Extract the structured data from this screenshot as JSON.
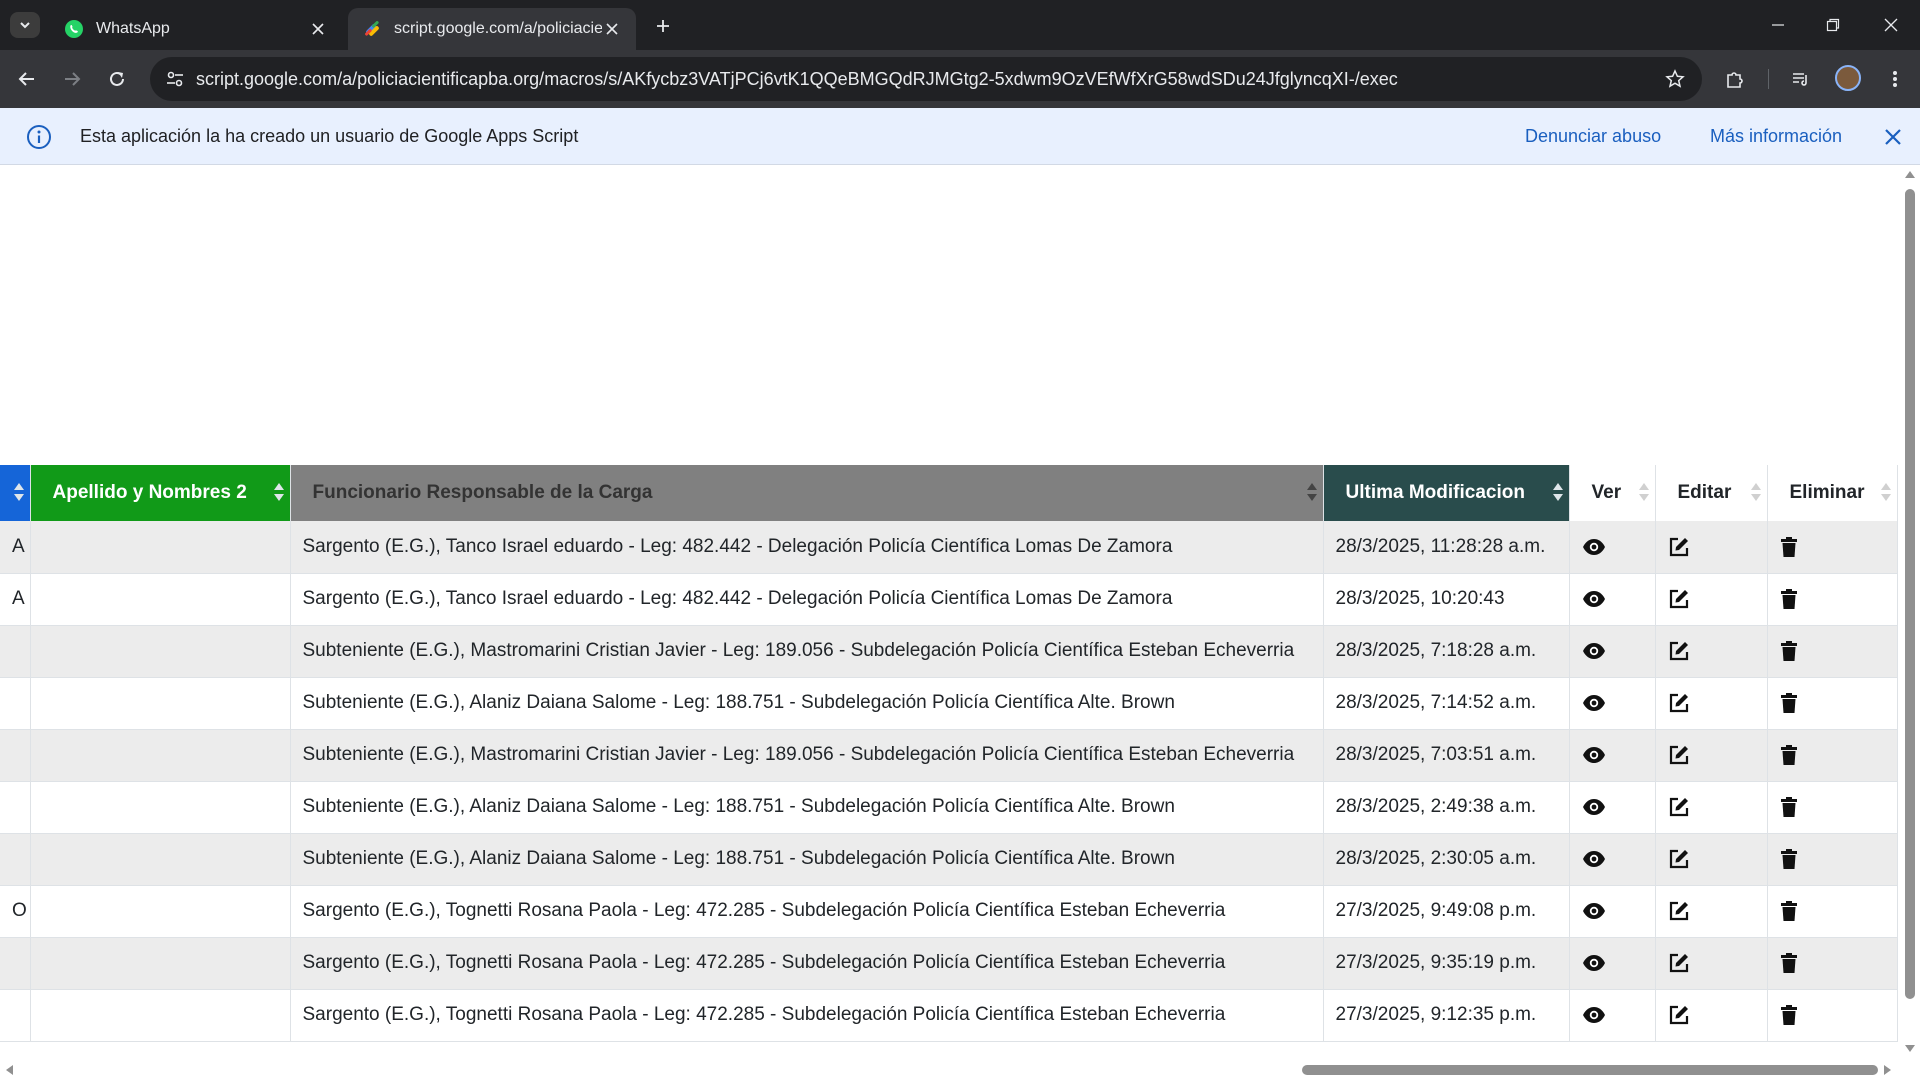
{
  "browser": {
    "tabs": [
      {
        "title": "WhatsApp",
        "active": false,
        "icon": "whatsapp-icon"
      },
      {
        "title": "script.google.com/a/policiacien",
        "active": true,
        "icon": "google-apps-script-icon"
      }
    ],
    "url": "script.google.com/a/policiacientificapba.org/macros/s/AKfycbz3VATjPCj6vtK1QQeBMGQdRJMGtg2-5xdwm9OzVEfWfXrG58wdSDu24JfglyncqXI-/exec"
  },
  "infobar": {
    "message": "Esta aplicación la ha creado un usuario de Google Apps Script",
    "report_link": "Denunciar abuso",
    "more_link": "Más información"
  },
  "table": {
    "headers": {
      "apellido2": "Apellido y Nombres 2",
      "funcionario": "Funcionario Responsable de la Carga",
      "ultima": "Ultima Modificacion",
      "ver": "Ver",
      "editar": "Editar",
      "eliminar": "Eliminar"
    },
    "rows": [
      {
        "left": "A",
        "apellido2": "",
        "funcionario": "Sargento (E.G.), Tanco Israel eduardo - Leg: 482.442 - Delegación Policía Científica Lomas De Zamora",
        "ultima": "28/3/2025, 11:28:28 a.m."
      },
      {
        "left": "A",
        "apellido2": "",
        "funcionario": "Sargento (E.G.), Tanco Israel eduardo - Leg: 482.442 - Delegación Policía Científica Lomas De Zamora",
        "ultima": "28/3/2025, 10:20:43"
      },
      {
        "left": "",
        "apellido2": "",
        "funcionario": "Subteniente (E.G.), Mastromarini Cristian Javier - Leg: 189.056 - Subdelegación Policía Científica Esteban Echeverria",
        "ultima": "28/3/2025, 7:18:28 a.m."
      },
      {
        "left": "",
        "apellido2": "",
        "funcionario": "Subteniente (E.G.), Alaniz Daiana Salome - Leg: 188.751 - Subdelegación Policía Científica Alte. Brown",
        "ultima": "28/3/2025, 7:14:52 a.m."
      },
      {
        "left": "",
        "apellido2": "",
        "funcionario": "Subteniente (E.G.), Mastromarini Cristian Javier - Leg: 189.056 - Subdelegación Policía Científica Esteban Echeverria",
        "ultima": "28/3/2025, 7:03:51 a.m."
      },
      {
        "left": "",
        "apellido2": "",
        "funcionario": "Subteniente (E.G.), Alaniz Daiana Salome - Leg: 188.751 - Subdelegación Policía Científica Alte. Brown",
        "ultima": "28/3/2025, 2:49:38 a.m."
      },
      {
        "left": "",
        "apellido2": "",
        "funcionario": "Subteniente (E.G.), Alaniz Daiana Salome - Leg: 188.751 - Subdelegación Policía Científica Alte. Brown",
        "ultima": "28/3/2025, 2:30:05 a.m."
      },
      {
        "left": "O",
        "apellido2": "",
        "funcionario": "Sargento (E.G.), Tognetti Rosana Paola - Leg: 472.285 - Subdelegación Policía Científica Esteban Echeverria",
        "ultima": "27/3/2025, 9:49:08 p.m."
      },
      {
        "left": "",
        "apellido2": "",
        "funcionario": "Sargento (E.G.), Tognetti Rosana Paola - Leg: 472.285 - Subdelegación Policía Científica Esteban Echeverria",
        "ultima": "27/3/2025, 9:35:19 p.m."
      },
      {
        "left": "",
        "apellido2": "",
        "funcionario": "Sargento (E.G.), Tognetti Rosana Paola - Leg: 472.285 - Subdelegación Policía Científica Esteban Echeverria",
        "ultima": "27/3/2025, 9:12:35 p.m."
      }
    ]
  },
  "colors": {
    "header_left": "#1565d8",
    "header_apellido": "#119a18",
    "header_funcionario": "#808080",
    "header_ultima": "#294c4c",
    "link": "#1a5fbf"
  }
}
